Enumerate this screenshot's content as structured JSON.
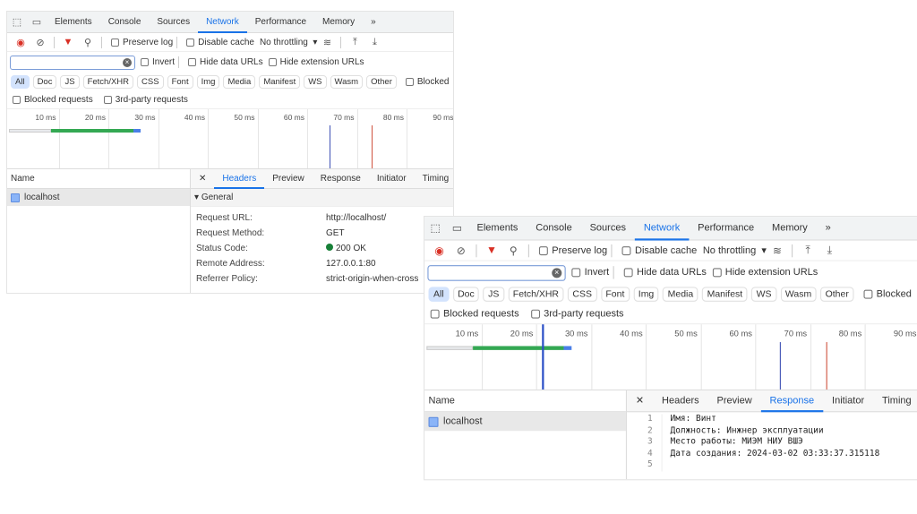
{
  "tabs": [
    "Elements",
    "Console",
    "Sources",
    "Network",
    "Performance",
    "Memory"
  ],
  "active_tab": "Network",
  "toolbar": {
    "preserve_log": "Preserve log",
    "disable_cache": "Disable cache",
    "throttling": "No throttling"
  },
  "filter": {
    "placeholder": "",
    "invert": "Invert",
    "hide_data": "Hide data URLs",
    "hide_ext": "Hide extension URLs"
  },
  "types": [
    "All",
    "Doc",
    "JS",
    "Fetch/XHR",
    "CSS",
    "Font",
    "Img",
    "Media",
    "Manifest",
    "WS",
    "Wasm",
    "Other"
  ],
  "blocked": "Blocked",
  "blocked_requests": "Blocked requests",
  "third_party": "3rd-party requests",
  "timeline": {
    "ticks": [
      "10 ms",
      "20 ms",
      "30 ms",
      "40 ms",
      "50 ms",
      "60 ms",
      "70 ms",
      "80 ms",
      "90 ms"
    ],
    "request_ms": [
      0,
      8.5,
      25,
      26.5
    ],
    "dom_content_loaded_ms": 64.5,
    "load_ms": 73,
    "hover_ms": 21
  },
  "list": {
    "header": "Name",
    "items": [
      "localhost"
    ]
  },
  "detail_tabs": [
    "Headers",
    "Preview",
    "Response",
    "Initiator",
    "Timing"
  ],
  "panel1": {
    "active_detail": "Headers",
    "section": "General",
    "headers": [
      {
        "k": "Request URL:",
        "v": "http://localhost/"
      },
      {
        "k": "Request Method:",
        "v": "GET"
      },
      {
        "k": "Status Code:",
        "v": "200 OK"
      },
      {
        "k": "Remote Address:",
        "v": "127.0.0.1:80"
      },
      {
        "k": "Referrer Policy:",
        "v": "strict-origin-when-cross"
      }
    ]
  },
  "panel2": {
    "active_detail": "Response",
    "lines": [
      "Имя: Винт",
      "Должность: Инжнер эксплуатации",
      "Место работы: МИЭМ НИУ ВШЭ",
      "Дата создания: 2024-03-02 03:33:37.315118",
      ""
    ]
  },
  "colors": {
    "accent": "#1a73e8",
    "green": "#34a853",
    "blue_line": "#3f51b5",
    "red_line": "#d0533f"
  }
}
